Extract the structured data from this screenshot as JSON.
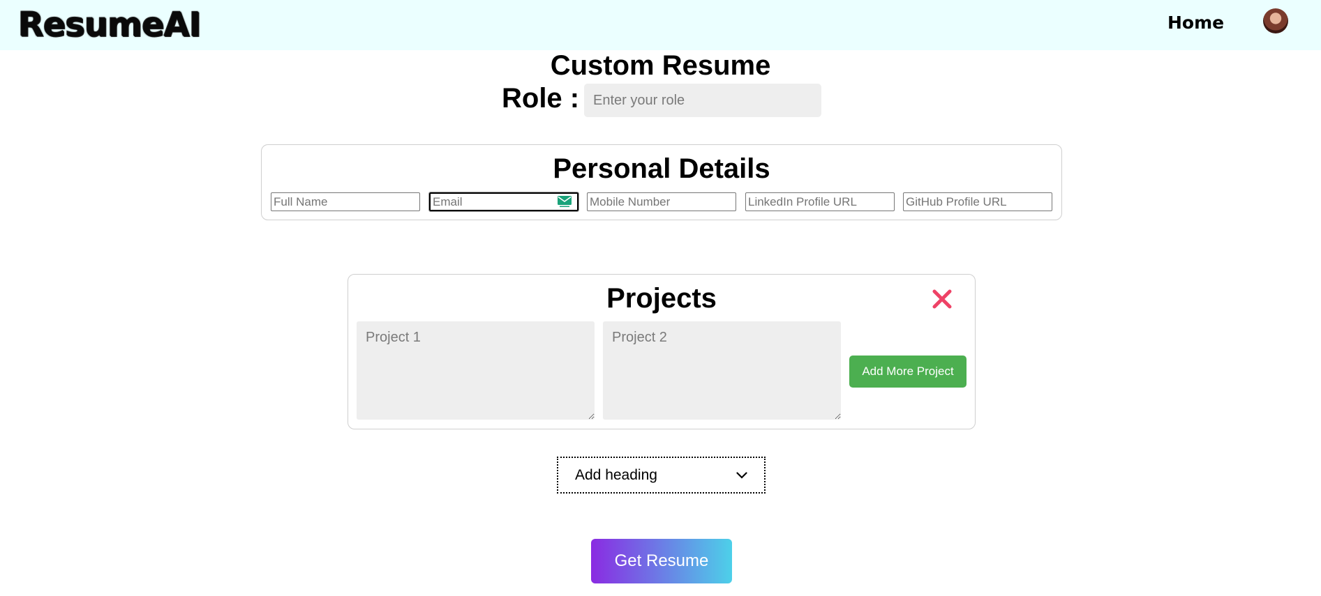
{
  "navbar": {
    "logo": "ResumeAI",
    "home_label": "Home"
  },
  "header": {
    "title": "Custom Resume",
    "role_label": "Role :",
    "role_placeholder": "Enter your role"
  },
  "personal_details": {
    "title": "Personal Details",
    "fields": [
      {
        "placeholder": "Full Name",
        "value": ""
      },
      {
        "placeholder": "Email",
        "value": ""
      },
      {
        "placeholder": "Mobile Number",
        "value": ""
      },
      {
        "placeholder": "LinkedIn Profile URL",
        "value": ""
      },
      {
        "placeholder": "GitHub Profile URL",
        "value": ""
      }
    ]
  },
  "projects": {
    "title": "Projects",
    "items": [
      {
        "placeholder": "Project 1",
        "value": ""
      },
      {
        "placeholder": "Project 2",
        "value": ""
      }
    ],
    "add_button": "Add More Project",
    "close_color": "#ee4266"
  },
  "add_heading": {
    "selected": "Add heading"
  },
  "get_resume_button": "Get Resume",
  "colors": {
    "navbar_bg": "#ebffff",
    "add_button": "#4caf50",
    "gradient_start": "#8a2be2",
    "gradient_end": "#4dd0e9"
  }
}
